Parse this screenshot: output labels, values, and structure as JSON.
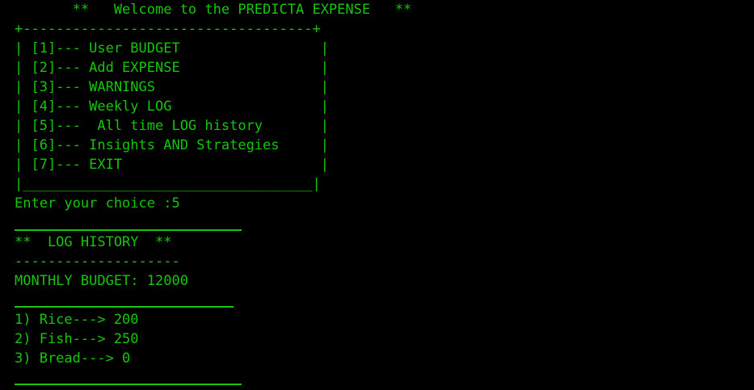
{
  "banner": "       **   Welcome to the PREDICTA EXPENSE   **",
  "menu": {
    "top_border": "+-----------------------------------+",
    "items": [
      "| [1]--- User BUDGET                 |",
      "| [2]--- Add EXPENSE                 |",
      "| [3]--- WARNINGS                    |",
      "| [4]--- Weekly LOG                  |",
      "| [5]---  All time LOG history       |",
      "| [6]--- Insights AND Strategies     |",
      "| [7]--- EXIT                        |"
    ],
    "bottom_border": "|___________________________________|"
  },
  "prompt": "Enter your choice :5",
  "log": {
    "title": "**  LOG HISTORY  **",
    "title_underline": "--------------------",
    "budget_line": "MONTHLY BUDGET: 12000",
    "entries": [
      "1) Rice---> 200",
      "2) Fish---> 250",
      "3) Bread---> 0"
    ]
  },
  "colors": {
    "background": "#000000",
    "text": "#16C60C"
  }
}
